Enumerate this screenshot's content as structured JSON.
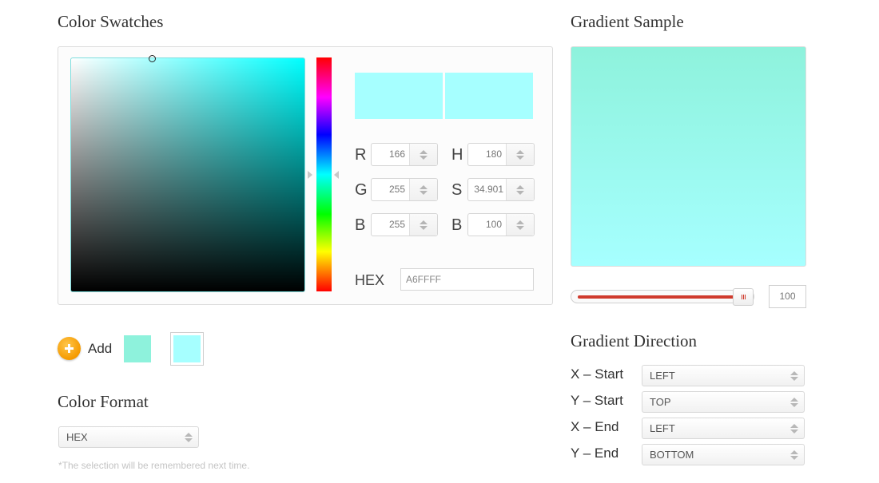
{
  "headings": {
    "color_swatches": "Color Swatches",
    "gradient_sample": "Gradient Sample",
    "color_format": "Color Format",
    "gradient_direction": "Gradient Direction"
  },
  "picker": {
    "current_color": "#A6FFFF",
    "hue_base_color": "#00FFFF",
    "preview_new_color": "#A6FFFF",
    "preview_old_color": "#A6FFFF",
    "rgb": [
      {
        "label": "R",
        "value": "166"
      },
      {
        "label": "G",
        "value": "255"
      },
      {
        "label": "B",
        "value": "255"
      }
    ],
    "hsb": [
      {
        "label": "H",
        "value": "180"
      },
      {
        "label": "S",
        "value": "34.901"
      },
      {
        "label": "B",
        "value": "100"
      }
    ],
    "hex_label": "HEX",
    "hex_value": "A6FFFF"
  },
  "swatches": {
    "add_label": "Add",
    "items": [
      {
        "color": "#8EF2DC"
      },
      {
        "color": "#A6FFFF",
        "selected": true
      }
    ]
  },
  "color_format": {
    "selected": "HEX",
    "note": "*The selection will be remembered next time."
  },
  "gradient": {
    "start_color": "#8EF2DC",
    "end_color": "#A6FFFF",
    "slider_value": "100",
    "slider_percent": 100,
    "direction": [
      {
        "label": "X – Start",
        "value": "LEFT"
      },
      {
        "label": "Y – Start",
        "value": "TOP"
      },
      {
        "label": "X – End",
        "value": "LEFT"
      },
      {
        "label": "Y – End",
        "value": "BOTTOM"
      }
    ]
  }
}
